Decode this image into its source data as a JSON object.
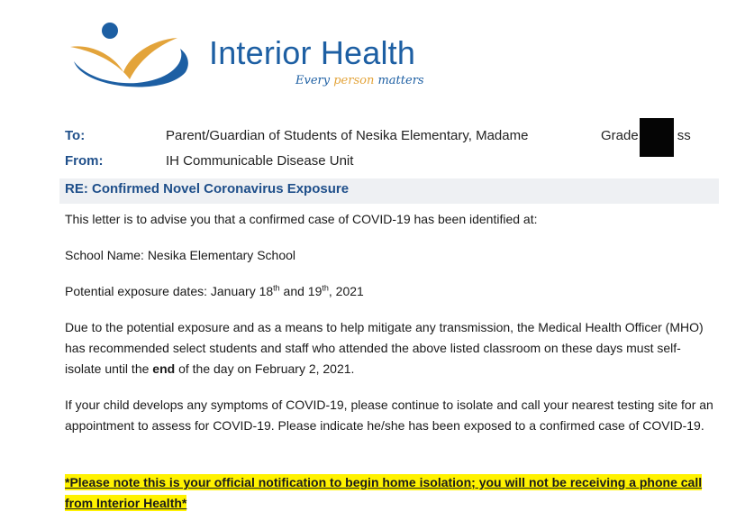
{
  "brand": {
    "name": "Interior Health",
    "tagline_1": "Every",
    "tagline_2": "person",
    "tagline_3": "matters"
  },
  "header": {
    "to_label": "To:",
    "to_value": "Parent/Guardian of Students of Nesika Elementary, Madame",
    "grade_text": "Grade",
    "grade_suffix": "ss",
    "from_label": "From:",
    "from_value": "IH Communicable Disease Unit"
  },
  "subject": "RE: Confirmed Novel Coronavirus Exposure",
  "body": {
    "p1": "This letter is to advise you that a confirmed case of COVID-19 has been identified at:",
    "p2": "School Name: Nesika Elementary School",
    "p3_a": "Potential exposure dates: January 18",
    "p3_sup1": "th",
    "p3_b": " and 19",
    "p3_sup2": "th",
    "p3_c": ", 2021",
    "p4_a": "Due to the potential exposure and as a means to help mitigate any transmission, the Medical Health Officer (MHO) has recommended select students and staff who attended the above listed classroom on these days must self-isolate until the ",
    "p4_bold": "end",
    "p4_b": " of the day on February 2, 2021.",
    "p5": "If your child develops any symptoms of COVID-19, please continue to isolate and call your nearest testing site for an appointment to assess for COVID-19.  Please indicate he/she has been exposed to a confirmed case of COVID-19.",
    "p6": "*Please note this is your official notification to begin home isolation; you will not be receiving a phone call from Interior Health*"
  },
  "colors": {
    "brand_blue": "#1d5fa3",
    "brand_gold": "#e3a43b",
    "highlight": "#fff200"
  }
}
